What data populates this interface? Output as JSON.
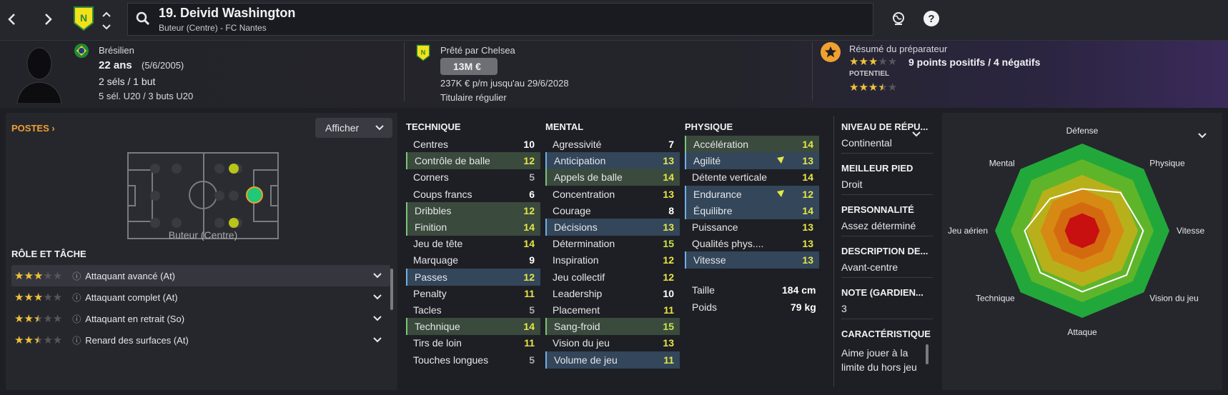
{
  "nav": {
    "back_icon": "chevron-left-icon",
    "forward_icon": "chevron-right-icon"
  },
  "player": {
    "title": "19. Deivid Washington",
    "subtitle": "Buteur (Centre) - FC Nantes",
    "nationality": "Brésilien",
    "age": "22 ans",
    "birthdate": "(5/6/2005)",
    "caps": "2 séls / 1 but",
    "youth_caps": "5 sél. U20 / 3 buts U20"
  },
  "contract": {
    "loan_label": "Prêté par Chelsea",
    "value": "13M €",
    "wage": "237K € p/m jusqu'au 29/6/2028",
    "status": "Titulaire régulier"
  },
  "scout": {
    "title": "Résumé du préparateur",
    "summary": "9 points positifs / 4 négatifs",
    "potential_label": "POTENTIEL",
    "current_stars": 3,
    "potential_stars": 3.5
  },
  "positions": {
    "title": "POSTES",
    "show_button": "Afficher",
    "position_label": "Buteur (Centre)"
  },
  "roles": {
    "title": "RÔLE ET TÂCHE",
    "items": [
      {
        "label": "Attaquant avancé (At)",
        "stars": 3
      },
      {
        "label": "Attaquant complet (At)",
        "stars": 3
      },
      {
        "label": "Attaquant en retrait (So)",
        "stars": 2.5
      },
      {
        "label": "Renard des surfaces (At)",
        "stars": 2.5
      }
    ]
  },
  "attributes": {
    "technical": {
      "title": "TECHNIQUE",
      "rows": [
        {
          "name": "Centres",
          "value": "10",
          "hl": "",
          "color": "white"
        },
        {
          "name": "Contrôle de balle",
          "value": "12",
          "hl": "green",
          "color": "yellow"
        },
        {
          "name": "Corners",
          "value": "5",
          "hl": "",
          "color": "grey"
        },
        {
          "name": "Coups francs",
          "value": "6",
          "hl": "",
          "color": "white"
        },
        {
          "name": "Dribbles",
          "value": "12",
          "hl": "green",
          "color": "yellow"
        },
        {
          "name": "Finition",
          "value": "14",
          "hl": "green",
          "color": "yellow"
        },
        {
          "name": "Jeu de tête",
          "value": "14",
          "hl": "",
          "color": "yellow"
        },
        {
          "name": "Marquage",
          "value": "9",
          "hl": "",
          "color": "white"
        },
        {
          "name": "Passes",
          "value": "12",
          "hl": "blue",
          "color": "yellow"
        },
        {
          "name": "Penalty",
          "value": "11",
          "hl": "",
          "color": "yellow"
        },
        {
          "name": "Tacles",
          "value": "5",
          "hl": "",
          "color": "grey"
        },
        {
          "name": "Technique",
          "value": "14",
          "hl": "green",
          "color": "yellow"
        },
        {
          "name": "Tirs de loin",
          "value": "11",
          "hl": "",
          "color": "yellow"
        },
        {
          "name": "Touches longues",
          "value": "5",
          "hl": "",
          "color": "grey"
        }
      ]
    },
    "mental": {
      "title": "MENTAL",
      "rows": [
        {
          "name": "Agressivité",
          "value": "7",
          "hl": "",
          "color": "white"
        },
        {
          "name": "Anticipation",
          "value": "13",
          "hl": "blue",
          "color": "yellow"
        },
        {
          "name": "Appels de balle",
          "value": "14",
          "hl": "green",
          "color": "yellow"
        },
        {
          "name": "Concentration",
          "value": "13",
          "hl": "",
          "color": "yellow"
        },
        {
          "name": "Courage",
          "value": "8",
          "hl": "",
          "color": "white"
        },
        {
          "name": "Décisions",
          "value": "13",
          "hl": "blue",
          "color": "yellow"
        },
        {
          "name": "Détermination",
          "value": "15",
          "hl": "",
          "color": "lime"
        },
        {
          "name": "Inspiration",
          "value": "12",
          "hl": "",
          "color": "yellow"
        },
        {
          "name": "Jeu collectif",
          "value": "12",
          "hl": "",
          "color": "yellow"
        },
        {
          "name": "Leadership",
          "value": "10",
          "hl": "",
          "color": "white"
        },
        {
          "name": "Placement",
          "value": "11",
          "hl": "",
          "color": "yellow"
        },
        {
          "name": "Sang-froid",
          "value": "15",
          "hl": "green",
          "color": "lime"
        },
        {
          "name": "Vision du jeu",
          "value": "13",
          "hl": "",
          "color": "yellow"
        },
        {
          "name": "Volume de jeu",
          "value": "11",
          "hl": "blue",
          "color": "yellow"
        }
      ]
    },
    "physical": {
      "title": "PHYSIQUE",
      "rows": [
        {
          "name": "Accélération",
          "value": "14",
          "hl": "green",
          "color": "yellow"
        },
        {
          "name": "Agilité",
          "value": "13",
          "hl": "blue",
          "color": "yellow",
          "arrow": true
        },
        {
          "name": "Détente verticale",
          "value": "14",
          "hl": "",
          "color": "yellow"
        },
        {
          "name": "Endurance",
          "value": "12",
          "hl": "blue",
          "color": "yellow",
          "arrow": true
        },
        {
          "name": "Équilibre",
          "value": "14",
          "hl": "blue",
          "color": "yellow"
        },
        {
          "name": "Puissance",
          "value": "13",
          "hl": "",
          "color": "yellow"
        },
        {
          "name": "Qualités phys....",
          "value": "13",
          "hl": "",
          "color": "yellow"
        },
        {
          "name": "Vitesse",
          "value": "13",
          "hl": "blue",
          "color": "yellow"
        }
      ],
      "height_label": "Taille",
      "height_value": "184 cm",
      "weight_label": "Poids",
      "weight_value": "79 kg"
    }
  },
  "info": {
    "reputation_label": "NIVEAU DE RÉPU...",
    "reputation_value": "Continental",
    "foot_label": "MEILLEUR PIED",
    "foot_value": "Droit",
    "personality_label": "PERSONNALITÉ",
    "personality_value": "Assez déterminé",
    "description_label": "DESCRIPTION DE...",
    "description_value": "Avant-centre",
    "gk_rating_label": "NOTE (GARDIEN...",
    "gk_rating_value": "3",
    "trait_label": "CARACTÉRISTIQUE",
    "trait_value": "Aime jouer à la limite du hors jeu"
  },
  "radar": {
    "labels": [
      "Défense",
      "Physique",
      "Vitesse",
      "Vision du jeu",
      "Attaque",
      "Technique",
      "Jeu aérien",
      "Mental"
    ],
    "colors": {
      "outer": "#22a83a",
      "ring2": "#5fb52a",
      "ring3": "#b8b01a",
      "ring4": "#d68a14",
      "ring5": "#d46a10",
      "core": "#c81010"
    }
  }
}
